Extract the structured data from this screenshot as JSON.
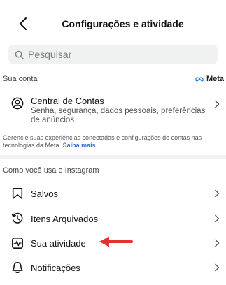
{
  "header": {
    "title": "Configurações e atividade"
  },
  "search": {
    "placeholder": "Pesquisar"
  },
  "account_section": {
    "label": "Sua conta",
    "meta_logo_text": "Meta",
    "central": {
      "title": "Central de Contas",
      "subtitle": "Senha, segurança, dados pessoais, preferências de anúncios"
    },
    "note_text": "Gerencie suas experiências conectadas e configurações de contas nas tecnologias da Meta. ",
    "note_link": "Saiba mais"
  },
  "usage_section": {
    "label": "Como você usa o Instagram",
    "items": [
      {
        "label": "Salvos",
        "icon": "bookmark-icon"
      },
      {
        "label": "Itens Arquivados",
        "icon": "archive-icon"
      },
      {
        "label": "Sua atividade",
        "icon": "activity-icon"
      },
      {
        "label": "Notificações",
        "icon": "bell-icon"
      }
    ]
  },
  "colors": {
    "annotation_arrow": "#e5322d",
    "link": "#3b6bd9"
  }
}
